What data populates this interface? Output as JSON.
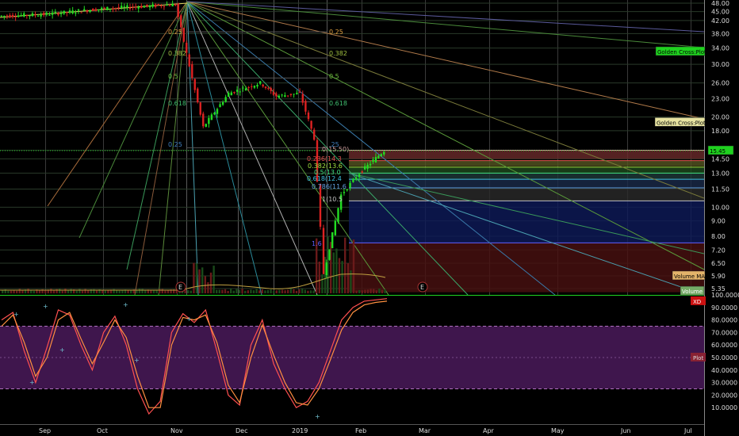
{
  "chart_data": [
    {
      "type": "candlestick",
      "title": "",
      "x_labels": [
        "Sep",
        "Oct",
        "Nov",
        "Dec",
        "2019",
        "Feb",
        "Mar",
        "Apr",
        "May",
        "Jun",
        "Jul"
      ],
      "y_ticks": [
        "48.00",
        "45.00",
        "42.00",
        "38.00",
        "34.00",
        "30.00",
        "26.00",
        "23.00",
        "20.00",
        "18.00",
        "15.50",
        "14.50",
        "13.00",
        "11.50",
        "10.00",
        "9.00",
        "8.00",
        "7.20",
        "6.50",
        "5.90",
        "5.35"
      ],
      "y_scale": "log",
      "ylim": [
        5.1,
        49
      ],
      "last_price": "15.45",
      "price_path": [
        {
          "date": "Aug 2018",
          "price": 43.5
        },
        {
          "date": "Sep 2018",
          "price": 44.0
        },
        {
          "date": "Oct 2018",
          "price": 46.0
        },
        {
          "date": "early Nov 2018",
          "price": 47.5
        },
        {
          "date": "mid Nov 2018",
          "price": 18.5
        },
        {
          "date": "late Nov 2018",
          "price": 24.0
        },
        {
          "date": "Dec 2018",
          "price": 26.0
        },
        {
          "date": "late Dec 2018",
          "price": 23.5
        },
        {
          "date": "early Jan 2019",
          "price": 24.0
        },
        {
          "date": "mid Jan 2019",
          "price": 17.0
        },
        {
          "date": "late Jan 2019",
          "price": 6.0
        },
        {
          "date": "end Jan 2019",
          "price": 11.0
        },
        {
          "date": "early Feb 2019",
          "price": 13.0
        },
        {
          "date": "mid Feb 2019",
          "price": 15.45
        }
      ],
      "fib_left": [
        {
          "level": "0.25"
        },
        {
          "level": "0.382"
        },
        {
          "level": "0.5"
        },
        {
          "level": "0.618"
        },
        {
          "level": "0.25"
        }
      ],
      "fib_right": [
        {
          "level": "0.25"
        },
        {
          "level": "0.382"
        },
        {
          "level": "0.5"
        },
        {
          "level": "0.618"
        },
        {
          "level": ".25"
        }
      ],
      "fib_retracement": [
        {
          "label": "0(15.50)",
          "color": "#d0a0a0"
        },
        {
          "label": "0.236(14.3",
          "color": "#e05050"
        },
        {
          "label": "0.382(13.6",
          "color": "#a0e040"
        },
        {
          "label": "0.5(13.0",
          "color": "#40e080"
        },
        {
          "label": "0.618(12.4",
          "color": "#40c0e0"
        },
        {
          "label": "0.786(11.6",
          "color": "#60a0e0"
        },
        {
          "label": "1(10.5",
          "color": "#c0c0c0"
        },
        {
          "label": "1.6",
          "color": "#6060ff"
        }
      ],
      "tags": [
        {
          "label": "Golden Cross:Plot",
          "bg": "#1fd21f",
          "fg": "#000"
        },
        {
          "label": "Golden Cross:Plot",
          "bg": "#e7e3a1",
          "fg": "#000"
        },
        {
          "label": "15.45",
          "bg": "#1fd21f",
          "fg": "#000"
        },
        {
          "label": "Volume MA",
          "bg": "#e3b36a",
          "fg": "#000"
        },
        {
          "label": "Volume",
          "bg": "#75aa66",
          "fg": "#fff"
        }
      ],
      "earnings_marker": "E",
      "legend": "right-side tags"
    },
    {
      "type": "line",
      "title": "",
      "y_ticks": [
        "100.0000",
        "90.0000",
        "80.0000",
        "70.0000",
        "60.0000",
        "50.0000",
        "40.0000",
        "30.0000",
        "20.0000",
        "10.0000"
      ],
      "ylim": [
        0,
        100
      ],
      "bands": [
        25,
        75
      ],
      "tags": [
        {
          "label": "XD",
          "bg": "#cc1111",
          "fg": "#fff"
        },
        {
          "label": "Plot",
          "bg": "#882233",
          "fg": "#ddd"
        }
      ],
      "series": [
        {
          "color": "#ff5050",
          "values": [
            80,
            86,
            55,
            30,
            58,
            88,
            84,
            60,
            40,
            70,
            83,
            60,
            25,
            5,
            15,
            70,
            85,
            78,
            88,
            55,
            20,
            12,
            60,
            80,
            45,
            25,
            10,
            15,
            30,
            55,
            80,
            90,
            95,
            96,
            97
          ]
        },
        {
          "color": "#ff9040",
          "values": [
            75,
            84,
            62,
            35,
            50,
            80,
            86,
            65,
            45,
            62,
            80,
            66,
            35,
            10,
            10,
            60,
            82,
            80,
            84,
            62,
            28,
            14,
            50,
            76,
            52,
            30,
            14,
            12,
            25,
            48,
            72,
            86,
            92,
            94,
            95
          ]
        }
      ]
    }
  ]
}
